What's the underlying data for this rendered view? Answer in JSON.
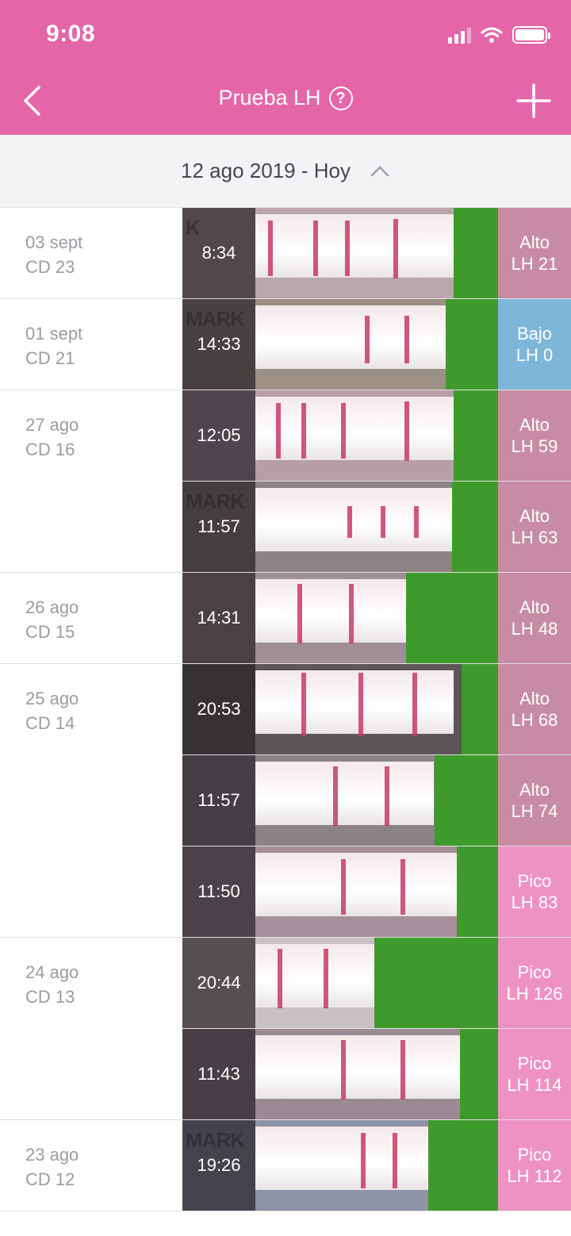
{
  "status_bar": {
    "time": "9:08"
  },
  "header": {
    "back_icon": "chevron-left-icon",
    "title": "Prueba LH",
    "help_icon": "question-circle-icon",
    "add_icon": "plus-icon"
  },
  "range": {
    "label": "12 ago 2019 - Hoy",
    "toggle_icon": "chevron-up-icon"
  },
  "colors": {
    "header": "#e466a8",
    "alto": "#c78ca3",
    "bajo": "#7eb6da",
    "pico": "#ee92c4"
  },
  "entries": [
    {
      "date": "03 sept",
      "cd": "CD 23",
      "time": "8:34",
      "level": "Alto",
      "lh": "LH 21",
      "kind": "alto"
    },
    {
      "date": "01 sept",
      "cd": "CD 21",
      "time": "14:33",
      "level": "Bajo",
      "lh": "LH 0",
      "kind": "bajo"
    },
    {
      "date": "27 ago",
      "cd": "CD 16",
      "time": "12:05",
      "level": "Alto",
      "lh": "LH 59",
      "kind": "alto"
    },
    {
      "date": "",
      "cd": "",
      "time": "11:57",
      "level": "Alto",
      "lh": "LH 63",
      "kind": "alto"
    },
    {
      "date": "26 ago",
      "cd": "CD 15",
      "time": "14:31",
      "level": "Alto",
      "lh": "LH 48",
      "kind": "alto"
    },
    {
      "date": "25 ago",
      "cd": "CD 14",
      "time": "20:53",
      "level": "Alto",
      "lh": "LH 68",
      "kind": "alto"
    },
    {
      "date": "",
      "cd": "",
      "time": "11:57",
      "level": "Alto",
      "lh": "LH 74",
      "kind": "alto"
    },
    {
      "date": "",
      "cd": "",
      "time": "11:50",
      "level": "Pico",
      "lh": "LH 83",
      "kind": "pico"
    },
    {
      "date": "24 ago",
      "cd": "CD 13",
      "time": "20:44",
      "level": "Pico",
      "lh": "LH 126",
      "kind": "pico"
    },
    {
      "date": "",
      "cd": "",
      "time": "11:43",
      "level": "Pico",
      "lh": "LH 114",
      "kind": "pico"
    },
    {
      "date": "23 ago",
      "cd": "CD 12",
      "time": "19:26",
      "level": "Pico",
      "lh": "LH 112",
      "kind": "pico"
    }
  ],
  "strip_marks": [
    "K",
    "MARK",
    "",
    "MARK",
    "",
    "",
    "",
    "",
    "",
    "",
    "MARK"
  ]
}
